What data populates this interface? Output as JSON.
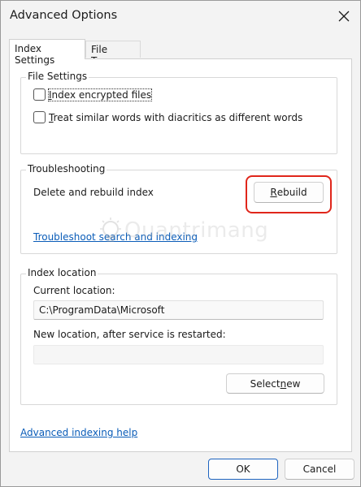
{
  "window": {
    "title": "Advanced Options"
  },
  "tabs": [
    {
      "label": "Index Settings",
      "active": true
    },
    {
      "label": "File Types",
      "active": false
    }
  ],
  "file_settings": {
    "legend": "File Settings",
    "options": [
      {
        "label_accel": "I",
        "label_rest": "ndex encrypted files",
        "checked": false
      },
      {
        "label_accel": "T",
        "label_rest": "reat similar words with diacritics as different words",
        "checked": false
      }
    ]
  },
  "troubleshooting": {
    "legend": "Troubleshooting",
    "rebuild_text": "Delete and rebuild index",
    "rebuild_button_accel": "R",
    "rebuild_button_rest": "ebuild",
    "troubleshoot_link": "Troubleshoot search and indexing"
  },
  "index_location": {
    "legend": "Index location",
    "current_label": "Current location:",
    "current_value": "C:\\ProgramData\\Microsoft",
    "new_label": "New location, after service is restarted:",
    "new_value": "",
    "select_new_pre": "Select ",
    "select_new_accel": "n",
    "select_new_post": "ew"
  },
  "footer": {
    "help_link": "Advanced indexing help",
    "ok_label": "OK",
    "cancel_label": "Cancel"
  },
  "watermark": {
    "text": "Quantrimang"
  },
  "colors": {
    "highlight_ring": "#e0261b",
    "link": "#0a5cb8",
    "primary_button_border": "#1e64c0"
  }
}
